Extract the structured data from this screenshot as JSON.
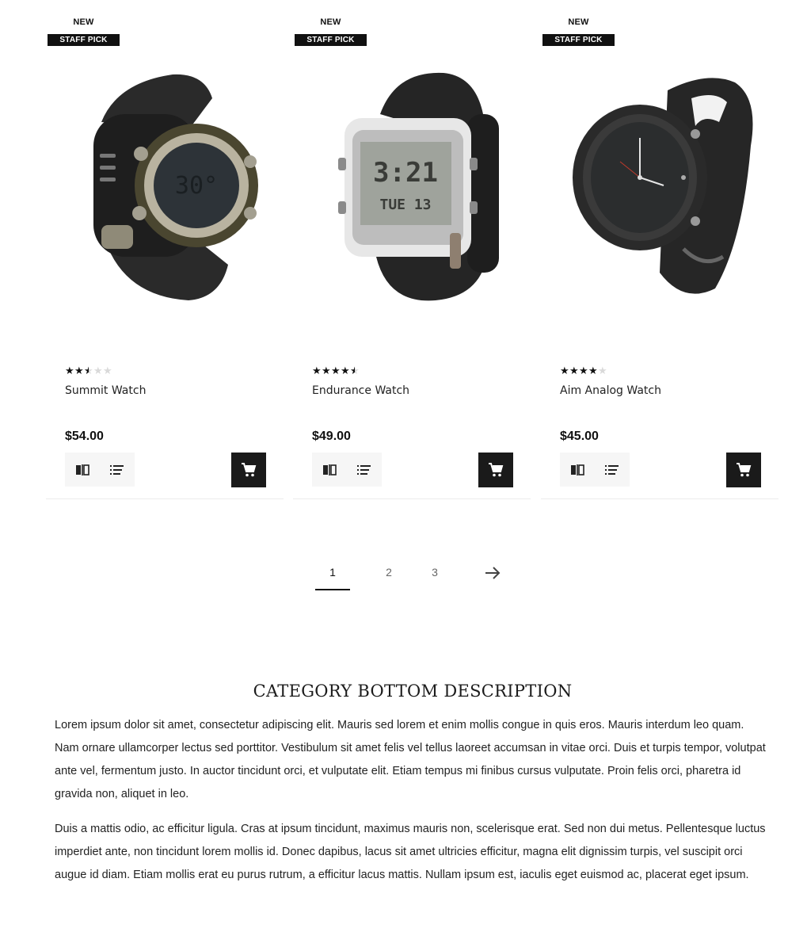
{
  "products": [
    {
      "badge_new": "NEW",
      "badge_pick": "STAFF PICK",
      "name": "Summit Watch",
      "price": "$54.00",
      "rating": 2.5,
      "image": "rugged-digital-watch-olive",
      "actions": {
        "compare": "compare-icon",
        "list": "list-icon",
        "cart": "cart-icon"
      }
    },
    {
      "badge_new": "NEW",
      "badge_pick": "STAFF PICK",
      "name": "Endurance Watch",
      "price": "$49.00",
      "rating": 4.5,
      "image": "silver-digital-watch",
      "actions": {
        "compare": "compare-icon",
        "list": "list-icon",
        "cart": "cart-icon"
      }
    },
    {
      "badge_new": "NEW",
      "badge_pick": "STAFF PICK",
      "name": "Aim Analog Watch",
      "price": "$45.00",
      "rating": 4,
      "image": "black-analog-watch",
      "actions": {
        "compare": "compare-icon",
        "list": "list-icon",
        "cart": "cart-icon"
      }
    }
  ],
  "pagination": {
    "pages": [
      "1",
      "2",
      "3"
    ],
    "current": "1",
    "next_icon": "arrow-right-icon"
  },
  "description": {
    "title": "CATEGORY BOTTOM DESCRIPTION",
    "paragraphs": [
      "Lorem ipsum dolor sit amet, consectetur adipiscing elit. Mauris sed lorem et enim mollis congue in quis eros. Mauris interdum leo quam. Nam ornare ullamcorper lectus sed porttitor. Vestibulum sit amet felis vel tellus laoreet accumsan in vitae orci. Duis et turpis tempor, volutpat ante vel, fermentum justo. In auctor tincidunt orci, et vulputate elit. Etiam tempus mi finibus cursus vulputate. Proin felis orci, pharetra id gravida non, aliquet in leo.",
      "Duis a mattis odio, ac efficitur ligula. Cras at ipsum tincidunt, maximus mauris non, scelerisque erat. Sed non dui metus. Pellentesque luctus imperdiet ante, non tincidunt lorem mollis id. Donec dapibus, lacus sit amet ultricies efficitur, magna elit dignissim turpis, vel suscipit orci augue id diam. Etiam mollis erat eu purus rutrum, a efficitur lacus mattis. Nullam ipsum est, iaculis eget euismod ac, placerat eget ipsum."
    ]
  },
  "colors": {
    "accent": "#111111",
    "cart_bg": "#1a1a1a",
    "action_bg": "#f6f6f6",
    "star_off": "#d9d9d9"
  }
}
